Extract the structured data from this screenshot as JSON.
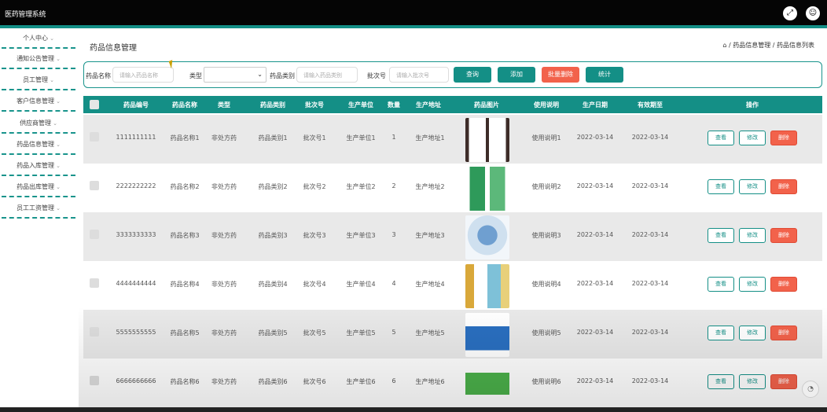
{
  "app": {
    "title": "医药管理系统"
  },
  "header": {
    "fullscreen_icon": "fullscreen-icon",
    "user_icon": "user-icon"
  },
  "sidebar": {
    "items": [
      {
        "label": "个人中心"
      },
      {
        "label": "通知公告管理"
      },
      {
        "label": "员工管理"
      },
      {
        "label": "客户信息管理"
      },
      {
        "label": "供应商管理"
      },
      {
        "label": "药品信息管理"
      },
      {
        "label": "药品入库管理"
      },
      {
        "label": "药品出库管理"
      },
      {
        "label": "员工工资管理"
      }
    ],
    "arrow": "⌄"
  },
  "page": {
    "title": "药品信息管理",
    "breadcrumb": "⌂ / 药品信息管理 / 药品信息列表"
  },
  "search": {
    "name_label": "药品名称",
    "name_placeholder": "请输入药品名称",
    "type_label": "类型",
    "category_label": "药品类别",
    "category_placeholder": "请输入药品类别",
    "batch_label": "批次号",
    "batch_placeholder": "请输入批次号",
    "query_button": "查询",
    "add_button": "添加",
    "batch_delete_button": "批量删除",
    "stats_button": "统计"
  },
  "table": {
    "headers": [
      "药品编号",
      "药品名称",
      "类型",
      "药品类别",
      "批次号",
      "生产单位",
      "数量",
      "生产地址",
      "药品图片",
      "使用说明",
      "生产日期",
      "有效期至",
      "操作"
    ],
    "row_buttons": {
      "view": "查看",
      "edit": "修改",
      "delete": "删除"
    },
    "rows": [
      {
        "code": "1111111111",
        "name": "药品名称1",
        "type": "非处方药",
        "category": "药品类别1",
        "batch": "批次号1",
        "maker": "生产单位1",
        "qty": "1",
        "address": "生产地址1",
        "usage": "使用说明1",
        "produced": "2022-03-14",
        "expires": "2022-03-14"
      },
      {
        "code": "2222222222",
        "name": "药品名称2",
        "type": "非处方药",
        "category": "药品类别2",
        "batch": "批次号2",
        "maker": "生产单位2",
        "qty": "2",
        "address": "生产地址2",
        "usage": "使用说明2",
        "produced": "2022-03-14",
        "expires": "2022-03-14"
      },
      {
        "code": "3333333333",
        "name": "药品名称3",
        "type": "非处方药",
        "category": "药品类别3",
        "batch": "批次号3",
        "maker": "生产单位3",
        "qty": "3",
        "address": "生产地址3",
        "usage": "使用说明3",
        "produced": "2022-03-14",
        "expires": "2022-03-14"
      },
      {
        "code": "4444444444",
        "name": "药品名称4",
        "type": "非处方药",
        "category": "药品类别4",
        "batch": "批次号4",
        "maker": "生产单位4",
        "qty": "4",
        "address": "生产地址4",
        "usage": "使用说明4",
        "produced": "2022-03-14",
        "expires": "2022-03-14"
      },
      {
        "code": "5555555555",
        "name": "药品名称5",
        "type": "非处方药",
        "category": "药品类别5",
        "batch": "批次号5",
        "maker": "生产单位5",
        "qty": "5",
        "address": "生产地址5",
        "usage": "使用说明5",
        "produced": "2022-03-14",
        "expires": "2022-03-14"
      },
      {
        "code": "6666666666",
        "name": "药品名称6",
        "type": "非处方药",
        "category": "药品类别6",
        "batch": "批次号6",
        "maker": "生产单位6",
        "qty": "6",
        "address": "生产地址6",
        "usage": "使用说明6",
        "produced": "2022-03-14",
        "expires": "2022-03-14"
      }
    ]
  },
  "colors": {
    "accent": "#148f86",
    "danger": "#f2624b",
    "topbar": "#050505"
  }
}
